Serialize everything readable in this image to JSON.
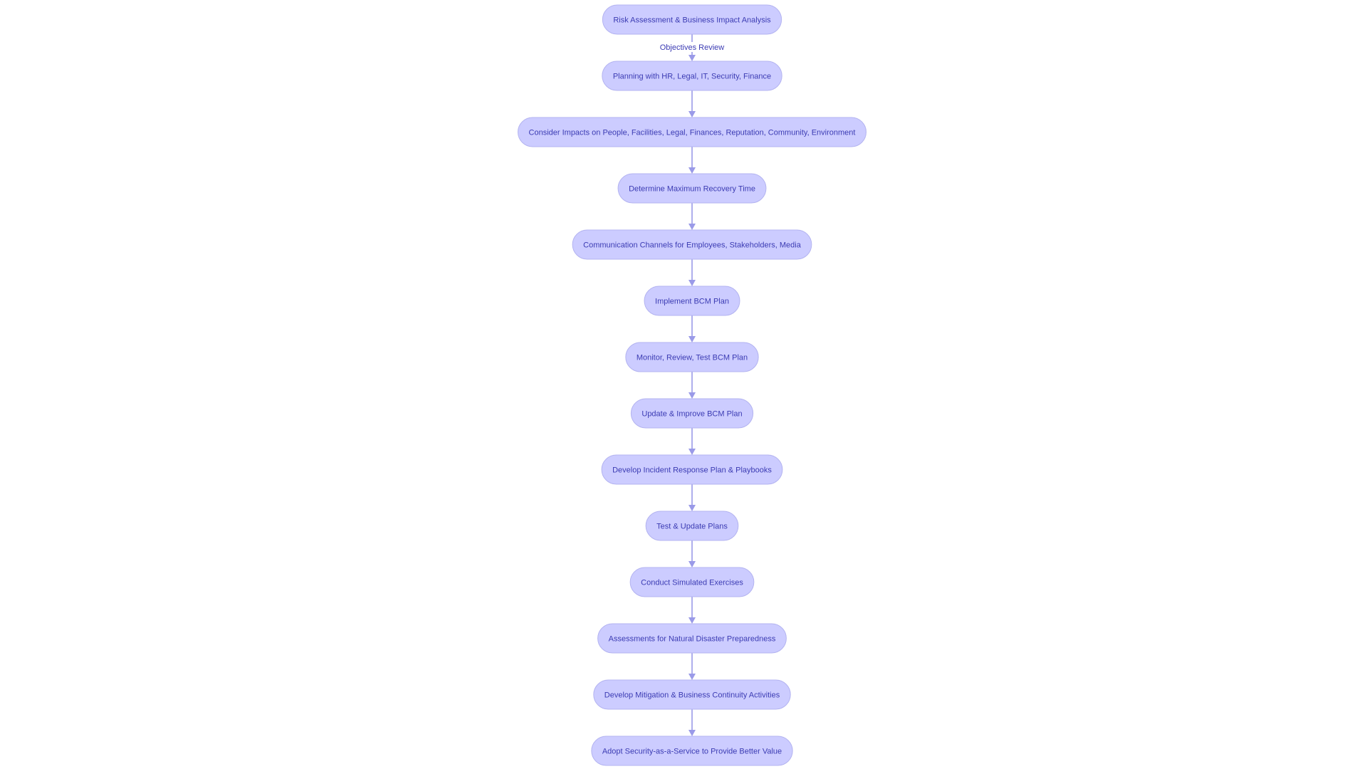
{
  "flowchart": {
    "direction": "top-to-bottom",
    "colors": {
      "node_fill": "#ccccff",
      "node_border": "#b3b3f0",
      "node_text": "#3b3bb3",
      "edge": "#9a9ae8",
      "background": "#ffffff"
    },
    "nodes": [
      {
        "id": "n1",
        "label": "Risk Assessment & Business Impact Analysis"
      },
      {
        "id": "n2",
        "label": "Planning with HR, Legal, IT, Security, Finance"
      },
      {
        "id": "n3",
        "label": "Consider Impacts on People, Facilities, Legal, Finances, Reputation, Community, Environment"
      },
      {
        "id": "n4",
        "label": "Determine Maximum Recovery Time"
      },
      {
        "id": "n5",
        "label": "Communication Channels for Employees, Stakeholders, Media"
      },
      {
        "id": "n6",
        "label": "Implement BCM Plan"
      },
      {
        "id": "n7",
        "label": "Monitor, Review, Test BCM Plan"
      },
      {
        "id": "n8",
        "label": "Update & Improve BCM Plan"
      },
      {
        "id": "n9",
        "label": "Develop Incident Response Plan & Playbooks"
      },
      {
        "id": "n10",
        "label": "Test & Update Plans"
      },
      {
        "id": "n11",
        "label": "Conduct Simulated Exercises"
      },
      {
        "id": "n12",
        "label": "Assessments for Natural Disaster Preparedness"
      },
      {
        "id": "n13",
        "label": "Develop Mitigation & Business Continuity Activities"
      },
      {
        "id": "n14",
        "label": "Adopt Security-as-a-Service to Provide Better Value"
      }
    ],
    "edges": [
      {
        "from": "n1",
        "to": "n2",
        "label": "Objectives Review"
      },
      {
        "from": "n2",
        "to": "n3",
        "label": ""
      },
      {
        "from": "n3",
        "to": "n4",
        "label": ""
      },
      {
        "from": "n4",
        "to": "n5",
        "label": ""
      },
      {
        "from": "n5",
        "to": "n6",
        "label": ""
      },
      {
        "from": "n6",
        "to": "n7",
        "label": ""
      },
      {
        "from": "n7",
        "to": "n8",
        "label": ""
      },
      {
        "from": "n8",
        "to": "n9",
        "label": ""
      },
      {
        "from": "n9",
        "to": "n10",
        "label": ""
      },
      {
        "from": "n10",
        "to": "n11",
        "label": ""
      },
      {
        "from": "n11",
        "to": "n12",
        "label": ""
      },
      {
        "from": "n12",
        "to": "n13",
        "label": ""
      },
      {
        "from": "n13",
        "to": "n14",
        "label": ""
      }
    ]
  }
}
